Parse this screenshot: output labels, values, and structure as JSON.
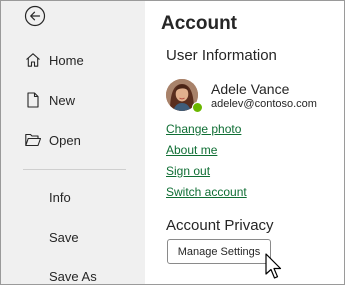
{
  "sidebar": {
    "back_icon": "back-arrow-icon",
    "items": [
      {
        "label": "Home",
        "icon": "home-icon"
      },
      {
        "label": "New",
        "icon": "new-document-icon"
      },
      {
        "label": "Open",
        "icon": "open-folder-icon"
      },
      {
        "label": "Info"
      },
      {
        "label": "Save"
      },
      {
        "label": "Save As"
      }
    ]
  },
  "main": {
    "title": "Account",
    "user_info": {
      "heading": "User Information",
      "name": "Adele Vance",
      "email": "adelev@contoso.com",
      "presence_color": "#6bb700",
      "links": [
        "Change photo",
        "About me",
        "Sign out",
        "Switch account"
      ]
    },
    "privacy": {
      "heading": "Account Privacy",
      "button_label": "Manage Settings"
    }
  },
  "colors": {
    "sidebar_bg": "#f0f0f0",
    "link": "#0f6e34",
    "text": "#262626"
  }
}
